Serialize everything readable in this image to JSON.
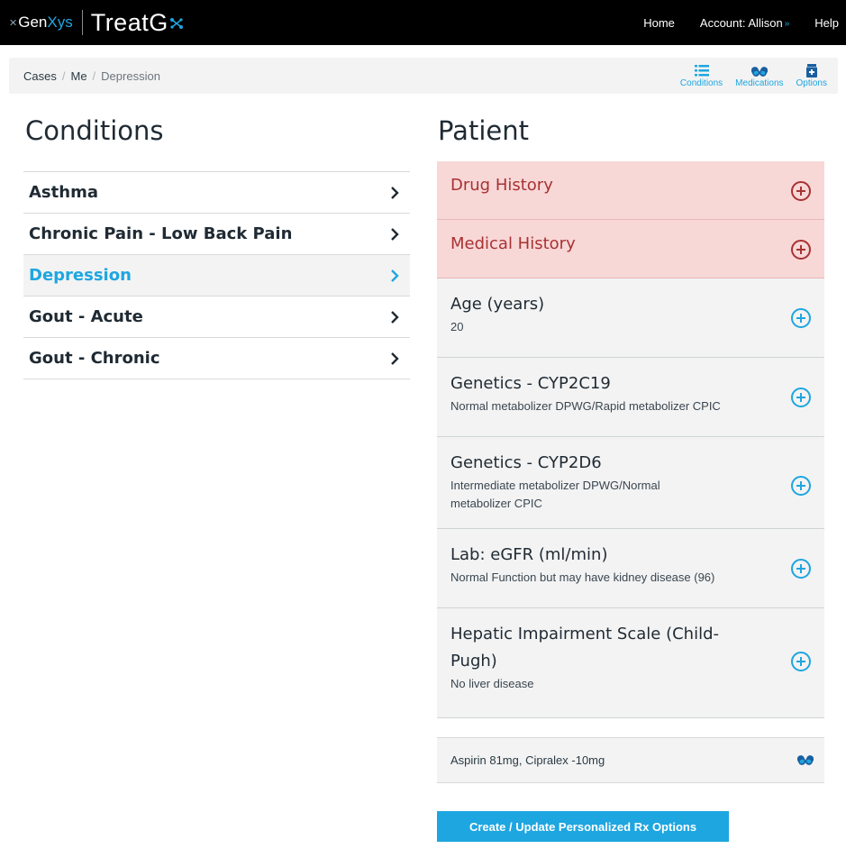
{
  "brand": {
    "mark": "✕",
    "company_a": "Gen",
    "company_b": "Xys",
    "product": "TreatG",
    "product_mark": "✕"
  },
  "nav": {
    "home": "Home",
    "account": "Account: Allison",
    "account_chevron": "»",
    "help": "Help"
  },
  "breadcrumb": {
    "items": [
      "Cases",
      "Me",
      "Depression"
    ],
    "separator": "/"
  },
  "tools": {
    "conditions": "Conditions",
    "medications": "Medications",
    "options": "Options"
  },
  "conditions": {
    "heading": "Conditions",
    "items": [
      {
        "label": "Asthma",
        "active": false
      },
      {
        "label": "Chronic Pain - Low Back Pain",
        "active": false
      },
      {
        "label": "Depression",
        "active": true
      },
      {
        "label": "Gout - Acute",
        "active": false
      },
      {
        "label": "Gout - Chronic",
        "active": false
      }
    ]
  },
  "patient": {
    "heading": "Patient",
    "drug_history": "Drug History",
    "medical_history": "Medical History",
    "age": {
      "title": "Age (years)",
      "value": "20"
    },
    "cyp2c19": {
      "title": "Genetics - CYP2C19",
      "value": "Normal metabolizer DPWG/Rapid metabolizer CPIC"
    },
    "cyp2d6": {
      "title": "Genetics - CYP2D6",
      "value_line1": "Intermediate metabolizer DPWG/Normal",
      "value_line2": "metabolizer CPIC"
    },
    "egfr": {
      "title": "Lab: eGFR (ml/min)",
      "value": "Normal Function but may have kidney disease (96)"
    },
    "hepatic": {
      "title_line1": "Hepatic Impairment Scale (Child-",
      "title_line2": "Pugh)",
      "value": "No liver disease"
    }
  },
  "medications": {
    "text": "Aspirin 81mg, Cipralex -10mg"
  },
  "actions": {
    "create": "Create / Update Personalized Rx Options"
  },
  "colors": {
    "accent": "#1ea6e0",
    "alert_bg": "#f8d7d7",
    "alert_text": "#a83232",
    "navbar": "#000000"
  }
}
